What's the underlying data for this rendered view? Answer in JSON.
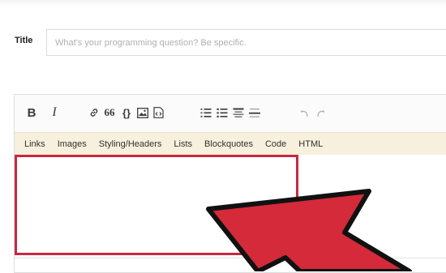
{
  "form": {
    "title_label": "Title",
    "title_placeholder": "What's your programming question? Be specific."
  },
  "toolbar": {
    "buttons": [
      {
        "name": "bold",
        "label": "B"
      },
      {
        "name": "italic",
        "label": "I"
      },
      {
        "name": "link",
        "icon": "link-icon"
      },
      {
        "name": "blockquote",
        "label": "66"
      },
      {
        "name": "code",
        "label": "{}"
      },
      {
        "name": "image",
        "icon": "image-icon"
      },
      {
        "name": "snippet",
        "icon": "snippet-icon"
      },
      {
        "name": "numbered-list",
        "icon": "numbered-list-icon"
      },
      {
        "name": "bulleted-list",
        "icon": "bulleted-list-icon"
      },
      {
        "name": "heading",
        "icon": "heading-icon"
      },
      {
        "name": "horizontal-rule",
        "icon": "horizontal-rule-icon"
      },
      {
        "name": "undo",
        "icon": "undo-icon"
      },
      {
        "name": "redo",
        "icon": "redo-icon"
      }
    ]
  },
  "help": {
    "items": [
      "Links",
      "Images",
      "Styling/Headers",
      "Lists",
      "Blockquotes",
      "Code",
      "HTML"
    ]
  },
  "colors": {
    "highlight": "#c8283f",
    "arrow": "#d42a3a",
    "help_bar_bg": "#f7f0dd"
  }
}
